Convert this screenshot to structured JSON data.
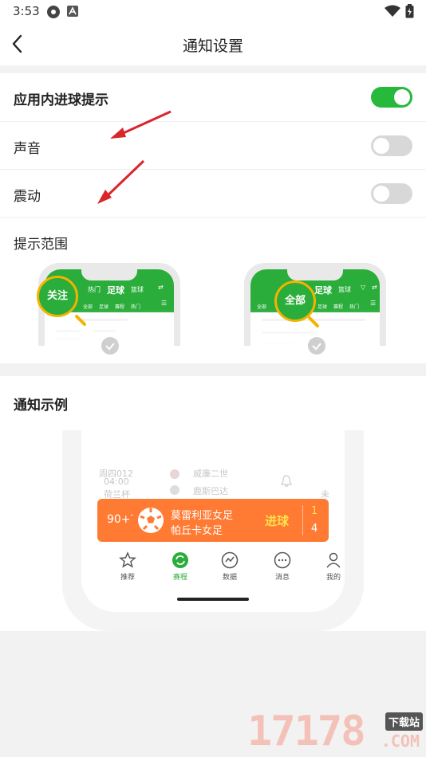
{
  "status_bar": {
    "time": "3:53",
    "colors": {
      "icon": "#333333"
    }
  },
  "nav": {
    "title": "通知设置",
    "back_icon": "chevron-left-icon"
  },
  "settings": {
    "goal_alert": {
      "label": "应用内进球提示",
      "enabled": true
    },
    "sound": {
      "label": "声音",
      "enabled": false
    },
    "vibration": {
      "label": "震动",
      "enabled": false
    }
  },
  "scope": {
    "title": "提示范围",
    "options": [
      {
        "label": "关注",
        "preview_tabs": [
          "热门",
          "足球",
          "篮球"
        ],
        "preview_subs": [
          "全部",
          "足球",
          "赛程",
          "热门"
        ]
      },
      {
        "label": "全部",
        "preview_tabs": [
          "足球",
          "篮球"
        ],
        "preview_subs": [
          "全部",
          "足球",
          "赛程",
          "热门"
        ]
      }
    ]
  },
  "example": {
    "title": "通知示例",
    "background_rows": [
      {
        "left": "周四012",
        "right": "威廉二世"
      },
      {
        "left": "04:00",
        "right": "鹿斯巴达"
      },
      {
        "left": "荷兰杯",
        "right": "未"
      }
    ],
    "notification": {
      "minute": "90+′",
      "team_a": "莫雷利亚女足",
      "team_b": "帕丘卡女足",
      "event": "进球",
      "score_a": "1",
      "score_b": "4"
    },
    "tabbar": [
      {
        "label": "推荐",
        "icon": "star-icon",
        "active": false
      },
      {
        "label": "赛程",
        "icon": "refresh-icon",
        "active": true
      },
      {
        "label": "数据",
        "icon": "chart-icon",
        "active": false
      },
      {
        "label": "消息",
        "icon": "message-icon",
        "active": false
      },
      {
        "label": "我的",
        "icon": "user-icon",
        "active": false
      }
    ]
  },
  "watermark": {
    "digits": "17178",
    "badge": "下载站",
    "suffix": ".COM"
  },
  "colors": {
    "accent": "#27b93b",
    "toggle_off": "#d8d8d8",
    "notification": "#ff7a33",
    "arrow": "#d9262b",
    "lens": "#f2b400"
  }
}
